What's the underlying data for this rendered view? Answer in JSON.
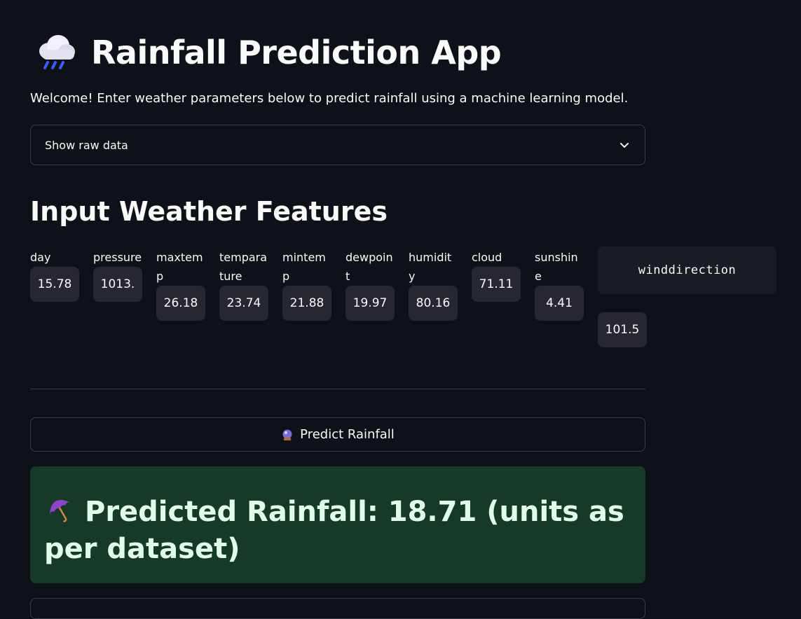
{
  "header": {
    "emoji_icon": "cloud-with-rain-icon",
    "title": "Rainfall Prediction App"
  },
  "welcome_text": "Welcome! Enter weather parameters below to predict rainfall using a machine learning model.",
  "expander": {
    "label": "Show raw data",
    "icon": "chevron-down-icon"
  },
  "section_title": "Input Weather Features",
  "features": [
    {
      "label": "day",
      "value": "15.78"
    },
    {
      "label": "pressure",
      "value": "1013."
    },
    {
      "label": "maxtemp",
      "value": "26.18"
    },
    {
      "label": "temparature",
      "value": "23.74"
    },
    {
      "label": "mintemp",
      "value": "21.88"
    },
    {
      "label": "dewpoint",
      "value": "19.97"
    },
    {
      "label": "humidity",
      "value": "80.16"
    },
    {
      "label": "cloud",
      "value": "71.11"
    },
    {
      "label": "sunshine",
      "value": "4.41"
    }
  ],
  "winddirection": {
    "label": "winddirection",
    "value": "101.5"
  },
  "predict_button": {
    "icon": "crystal-ball-icon",
    "label": "Predict Rainfall"
  },
  "result": {
    "icon": "umbrella-icon",
    "text": "Predicted Rainfall: 18.71 (units as per dataset)"
  },
  "colors": {
    "background": "#0e1117",
    "input_bg": "#262730",
    "success_bg": "#173928",
    "success_text": "#dffde9",
    "border": "#3a3e4a"
  }
}
